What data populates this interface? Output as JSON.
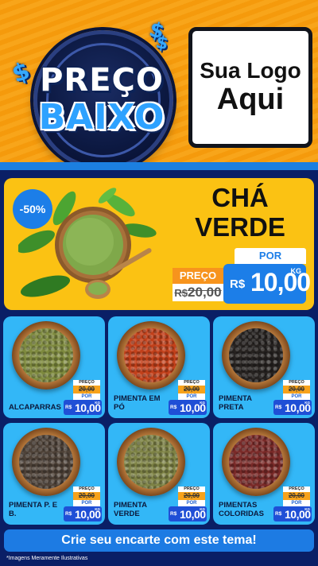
{
  "header": {
    "badge_line1": "PREÇO",
    "badge_line2": "BAIXO",
    "dollar_symbol": "$",
    "logo_line1": "Sua Logo",
    "logo_line2": "Aqui"
  },
  "featured": {
    "discount": "-50%",
    "title_line1": "CHÁ",
    "title_line2": "VERDE",
    "old_price_label": "PREÇO",
    "old_price_currency": "R$",
    "old_price_value": "20,00",
    "new_price_label": "POR",
    "new_price_currency": "R$",
    "new_price_value": "10,00",
    "new_price_unit": "KG",
    "image_icon": "green-tea-powder-bowl-icon"
  },
  "products": [
    {
      "name": "ALCAPARRAS",
      "old_label": "PREÇO",
      "old_price": "20,00",
      "new_label": "POR",
      "currency": "R$",
      "new_price": "10,00",
      "unit": "KG",
      "spice_color": "#7e8a3e"
    },
    {
      "name": "PIMENTA EM PÓ",
      "old_label": "PREÇO",
      "old_price": "20,00",
      "new_label": "POR",
      "currency": "R$",
      "new_price": "10,00",
      "unit": "KG",
      "spice_color": "#c2401a"
    },
    {
      "name": "PIMENTA PRETA",
      "old_label": "PREÇO",
      "old_price": "20,00",
      "new_label": "POR",
      "currency": "R$",
      "new_price": "10,00",
      "unit": "KG",
      "spice_color": "#262220"
    },
    {
      "name": "PIMENTA P. E B.",
      "old_label": "PREÇO",
      "old_price": "20,00",
      "new_label": "POR",
      "currency": "R$",
      "new_price": "10,00",
      "unit": "KG",
      "spice_color": "#4e4238"
    },
    {
      "name": "PIMENTA VERDE",
      "old_label": "PREÇO",
      "old_price": "20,00",
      "new_label": "POR",
      "currency": "R$",
      "new_price": "10,00",
      "unit": "KG",
      "spice_color": "#7d8244"
    },
    {
      "name": "PIMENTAS COLORIDAS",
      "old_label": "PREÇO",
      "old_price": "20,00",
      "new_label": "POR",
      "currency": "R$",
      "new_price": "10,00",
      "unit": "KG",
      "spice_color": "#7a2a28"
    }
  ],
  "cta": {
    "label": "Crie seu encarte com este tema!"
  },
  "footer": {
    "disclaimer": "*Imagens Meramente Ilustrativas"
  },
  "colors": {
    "header_orange": "#f59a0c",
    "accent_blue": "#1c7ee8",
    "featured_yellow": "#fbc213",
    "card_blue": "#33b7f7",
    "page_navy": "#0a1f66"
  }
}
